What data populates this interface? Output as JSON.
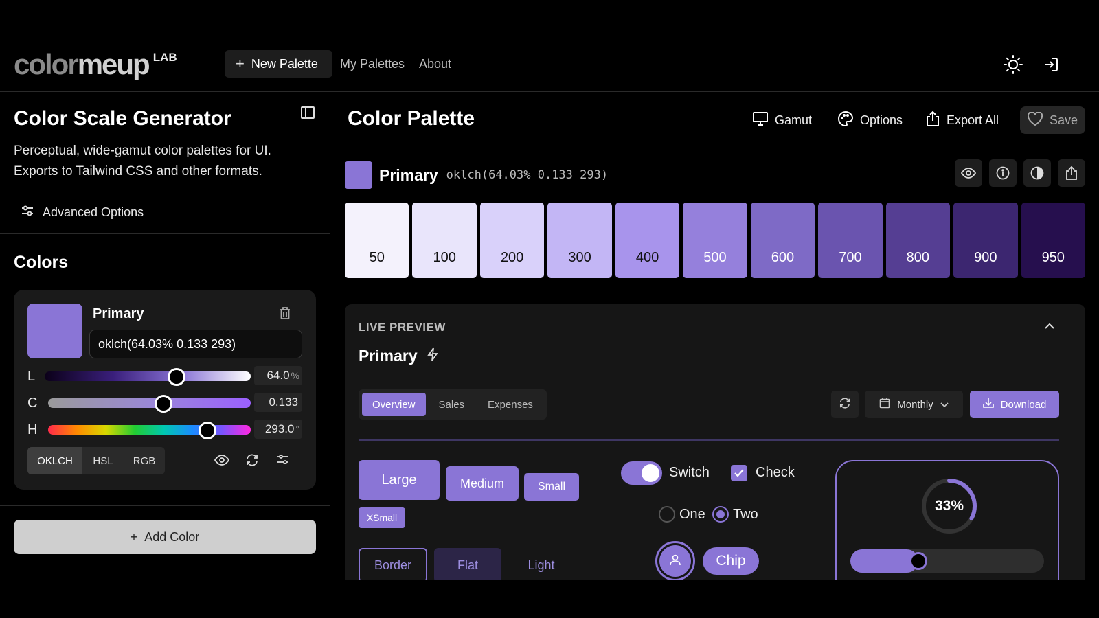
{
  "nav": {
    "logo_light": "color",
    "logo_bold": "meup",
    "logo_tail": "",
    "logo_lab": "LAB",
    "new_palette": "New Palette",
    "my_palettes": "My Palettes",
    "about": "About",
    "icons": [
      "sun-icon",
      "login-icon"
    ]
  },
  "sidebar": {
    "title": "Color Scale Generator",
    "description": "Perceptual, wide-gamut color palettes for UI. Exports to Tailwind CSS and other formats.",
    "advanced_options": "Advanced Options",
    "colors_heading": "Colors",
    "color_card": {
      "name": "Primary",
      "value": "oklch(64.03% 0.133 293)",
      "swatch_color": "#8a75d6",
      "sliders": [
        {
          "label": "L",
          "value": "64.0",
          "unit": "%",
          "position": 0.64
        },
        {
          "label": "C",
          "value": "0.133",
          "unit": "",
          "position": 0.57
        },
        {
          "label": "H",
          "value": "293.0",
          "unit": "°",
          "position": 0.787
        }
      ],
      "modes": [
        "OKLCH",
        "HSL",
        "RGB"
      ],
      "active_mode": "OKLCH"
    },
    "add_color": "Add Color"
  },
  "main": {
    "title": "Color Palette",
    "toolbar": {
      "gamut": "Gamut",
      "options": "Options",
      "export_all": "Export All",
      "save": "Save"
    },
    "primary": {
      "name": "Primary",
      "value": "oklch(64.03% 0.133 293)",
      "color": "#8a75d6"
    },
    "scale": [
      {
        "label": "50",
        "color": "#f4f2fc",
        "text": "#111"
      },
      {
        "label": "100",
        "color": "#e9e5fb",
        "text": "#111"
      },
      {
        "label": "200",
        "color": "#d9d1fa",
        "text": "#111"
      },
      {
        "label": "300",
        "color": "#c3b6f5",
        "text": "#111"
      },
      {
        "label": "400",
        "color": "#a894ec",
        "text": "#111"
      },
      {
        "label": "500",
        "color": "#9580dc",
        "text": "#fff"
      },
      {
        "label": "600",
        "color": "#7e6ac6",
        "text": "#fff"
      },
      {
        "label": "700",
        "color": "#6a54af",
        "text": "#fff"
      },
      {
        "label": "800",
        "color": "#553e93",
        "text": "#fff"
      },
      {
        "label": "900",
        "color": "#3c2670",
        "text": "#fff"
      },
      {
        "label": "950",
        "color": "#260f4e",
        "text": "#fff"
      }
    ],
    "live_preview": {
      "heading": "LIVE PREVIEW",
      "name": "Primary",
      "tabs": [
        "Overview",
        "Sales",
        "Expenses"
      ],
      "active_tab": "Overview",
      "period": "Monthly",
      "download": "Download",
      "buttons": [
        "Large",
        "Medium",
        "Small",
        "XSmall"
      ],
      "variant_buttons": [
        "Border",
        "Flat",
        "Light"
      ],
      "switch_label": "Switch",
      "switch_on": true,
      "check_label": "Check",
      "checked": true,
      "radios": [
        "One",
        "Two"
      ],
      "selected_radio": "Two",
      "chip": "Chip",
      "progress_label": "33%",
      "progress": 0.33,
      "slider_value": 0.35
    }
  }
}
